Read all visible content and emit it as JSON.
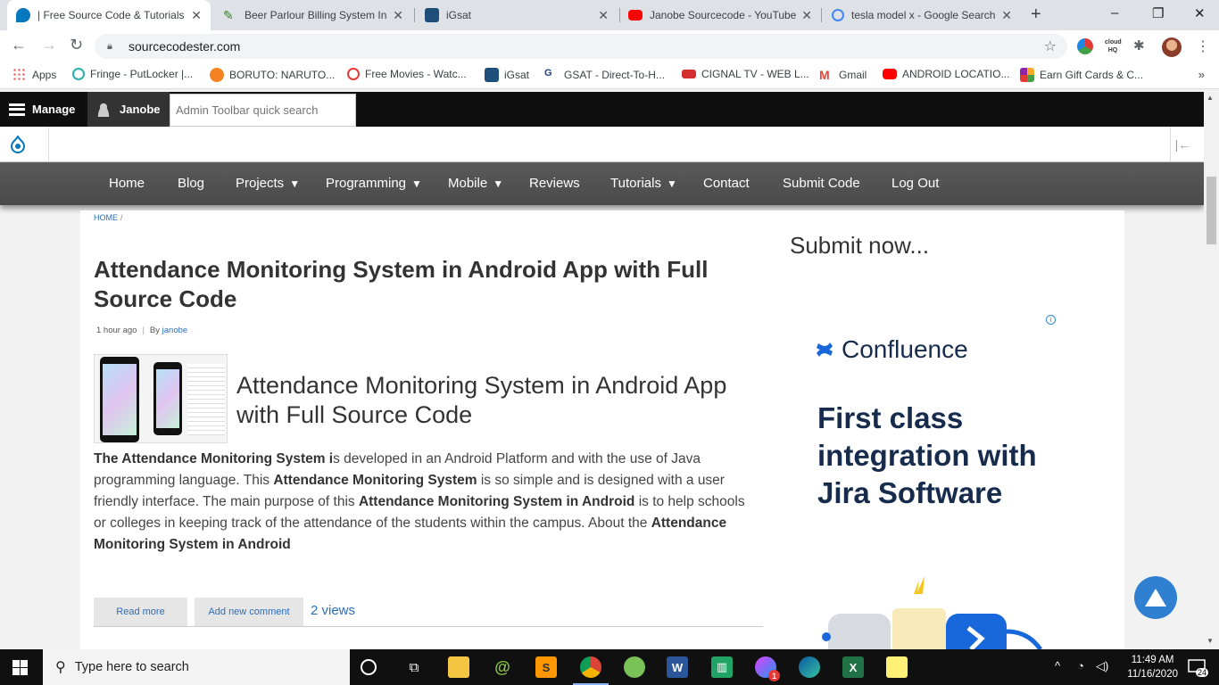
{
  "browser": {
    "tabs": [
      {
        "title": "| Free Source Code & Tutorials",
        "favicon": "drupal-icon",
        "color": "#0678be",
        "active": true
      },
      {
        "title": "Beer Parlour Billing System In V",
        "favicon": "leaf-icon",
        "color": "#3a7d23",
        "active": false
      },
      {
        "title": "iGsat",
        "favicon": "igsat-icon",
        "color": "#1e4f7a",
        "active": false
      },
      {
        "title": "Janobe Sourcecode - YouTube",
        "favicon": "youtube-icon",
        "color": "#ff0000",
        "active": false
      },
      {
        "title": "tesla model x - Google Search",
        "favicon": "google-icon",
        "color": "#4285f4",
        "active": false
      }
    ],
    "new_tab_symbol": "+",
    "url": "sourcecodester.com",
    "window_controls": {
      "minimize": "–",
      "restore": "❐",
      "close": "✕"
    },
    "bookmarks": [
      {
        "label": "Apps",
        "color": "#e8453c"
      },
      {
        "label": "Fringe - PutLocker |...",
        "color": "#2ab0a8"
      },
      {
        "label": "BORUTO: NARUTO...",
        "color": "#f58220"
      },
      {
        "label": "Free Movies - Watc...",
        "color": "#e53935"
      },
      {
        "label": "iGsat",
        "color": "#1e4f7a"
      },
      {
        "label": "GSAT - Direct-To-H...",
        "color": "#1d3c87"
      },
      {
        "label": "CIGNAL TV - WEB L...",
        "color": "#d32f2f"
      },
      {
        "label": "Gmail",
        "color": "#ea4335"
      },
      {
        "label": "ANDROID LOCATIO...",
        "color": "#ff0000"
      },
      {
        "label": "Earn Gift Cards & C...",
        "color": "#f9a825"
      }
    ],
    "bookmarks_more": "»"
  },
  "admin": {
    "manage_label": "Manage",
    "user_label": "Janobe",
    "search_placeholder": "Admin Toolbar quick search"
  },
  "nav": {
    "items": [
      {
        "label": "Home",
        "caret": false
      },
      {
        "label": "Blog",
        "caret": false
      },
      {
        "label": "Projects",
        "caret": true
      },
      {
        "label": "Programming",
        "caret": true
      },
      {
        "label": "Mobile",
        "caret": true
      },
      {
        "label": "Reviews",
        "caret": false
      },
      {
        "label": "Tutorials",
        "caret": true
      },
      {
        "label": "Contact",
        "caret": false
      },
      {
        "label": "Submit Code",
        "caret": false
      },
      {
        "label": "Log Out",
        "caret": false
      }
    ]
  },
  "article": {
    "breadcrumb_home": "HOME",
    "breadcrumb_sep": "/",
    "title": "Attendance Monitoring System in Android App with Full Source Code",
    "time": "1 hour ago",
    "by_label": "By",
    "author": "janobe",
    "sub_title": "Attendance Monitoring System in Android App with Full Source Code",
    "body_segments": [
      {
        "t": "The Attendance Monitoring System i",
        "b": true
      },
      {
        "t": "s developed in an Android Platform and with the use of Java programming language. This ",
        "b": false
      },
      {
        "t": "Attendance Monitoring System",
        "b": true
      },
      {
        "t": "  is so simple and is designed with a user friendly interface. The main purpose of this ",
        "b": false
      },
      {
        "t": "Attendance Monitoring System in Android",
        "b": true
      },
      {
        "t": " is to help schools or colleges in keeping track of the attendance of the students within the campus. About the ",
        "b": false
      },
      {
        "t": "Attendance Monitoring System in Android",
        "b": true
      }
    ],
    "read_more": "Read more",
    "add_comment": "Add new comment",
    "views": "2 views"
  },
  "sidebar": {
    "heading": "Submit now...",
    "ad_info_symbol": "i",
    "ad_brand": "Confluence",
    "ad_headline": "First class integration with Jira Software"
  },
  "taskbar": {
    "search_placeholder": "Type here to search",
    "time": "11:49 AM",
    "date": "11/16/2020",
    "notifications": "24",
    "mail_badge": "1"
  }
}
